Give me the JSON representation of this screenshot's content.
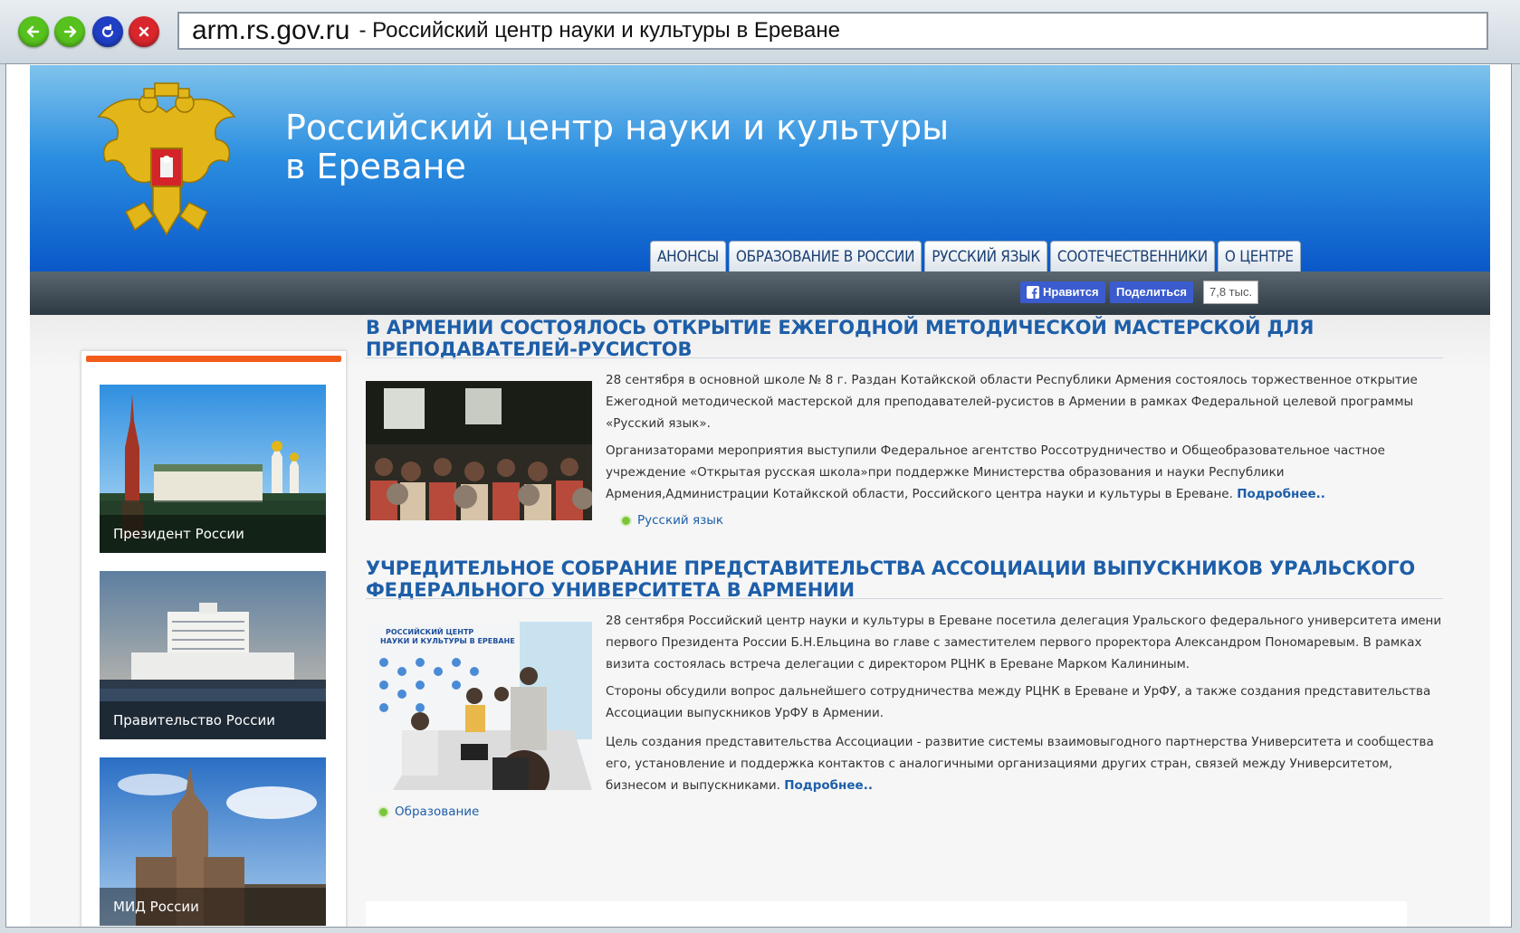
{
  "browser": {
    "domain": "arm.rs.gov.ru",
    "page_title": "- Российский центр науки и культуры  в Ереване"
  },
  "header": {
    "title_line1": "Российский центр науки и культуры",
    "title_line2": "в Ереване"
  },
  "menu": [
    "АНОНСЫ",
    "ОБРАЗОВАНИЕ В РОССИИ",
    "РУССКИЙ ЯЗЫК",
    "СООТЕЧЕСТВЕННИКИ",
    "О ЦЕНТРЕ"
  ],
  "social": {
    "like_label": "Нравится",
    "share_label": "Поделиться",
    "count": "7,8 тыс."
  },
  "sidebar": {
    "banners": [
      {
        "label": "Президент России",
        "icon": "kremlin-image"
      },
      {
        "label": "Правительство России",
        "icon": "white-house-image"
      },
      {
        "label": "МИД России",
        "icon": "mfa-building-image"
      }
    ]
  },
  "articles": [
    {
      "title": "В АРМЕНИИ СОСТОЯЛОСЬ ОТКРЫТИЕ ЕЖЕГОДНОЙ МЕТОДИЧЕСКОЙ МАСТЕРСКОЙ ДЛЯ ПРЕПОДАВАТЕЛЕЙ-РУСИСТОВ",
      "paragraphs": [
        "28 сентября в основной школе № 8 г. Раздан Котайкской области Республики Армения состоялось торжественное открытие Ежегодной методической мастерской для преподавателей-русистов в Армении в рамках Федеральной целевой программы «Русский язык».",
        "Организаторами мероприятия выступили Федеральное агентство Россотрудничество и Общеобразовательное частное учреждение «Открытая русская школа»при поддержке Министерства образования и науки Республики Армения,Администрации Котайкской области, Российского центра науки и культуры в Ереване."
      ],
      "more": "Подробнее..",
      "tag": "Русский язык"
    },
    {
      "title": "УЧРЕДИТЕЛЬНОЕ СОБРАНИЕ ПРЕДСТАВИТЕЛЬСТВА АССОЦИАЦИИ ВЫПУСКНИКОВ УРАЛЬСКОГО ФЕДЕРАЛЬНОГО УНИВЕРСИТЕТА В АРМЕНИИ",
      "paragraphs": [
        "28 сентября Российский центр науки и культуры в Ереване посетила  делегация Уральского федерального университета имени первого Президента России Б.Н.Ельцина во главе с заместителем первого проректора Александром Пономаревым. В рамках визита состоялась встреча делегации с директором РЦНК в Ереване Марком Калининым.",
        "Стороны обсудили вопрос дальнейшего сотрудничества между РЦНК в Ереване и УрФУ, а также создания представительства Ассоциации выпускников УрФУ в Армении.",
        "Цель создания представительства Ассоциации - развитие системы взаимовыгодного партнерства Университета и сообщества его, установление и поддержка контактов с аналогичными организациями других стран, связей между Университетом, бизнесом и выпускниками."
      ],
      "more": "Подробнее..",
      "tag": "Образование",
      "photo_caption": "РОССИЙСКИЙ ЦЕНТР НАУКИ И КУЛЬТУРЫ В ЕРЕВАНЕ"
    }
  ]
}
